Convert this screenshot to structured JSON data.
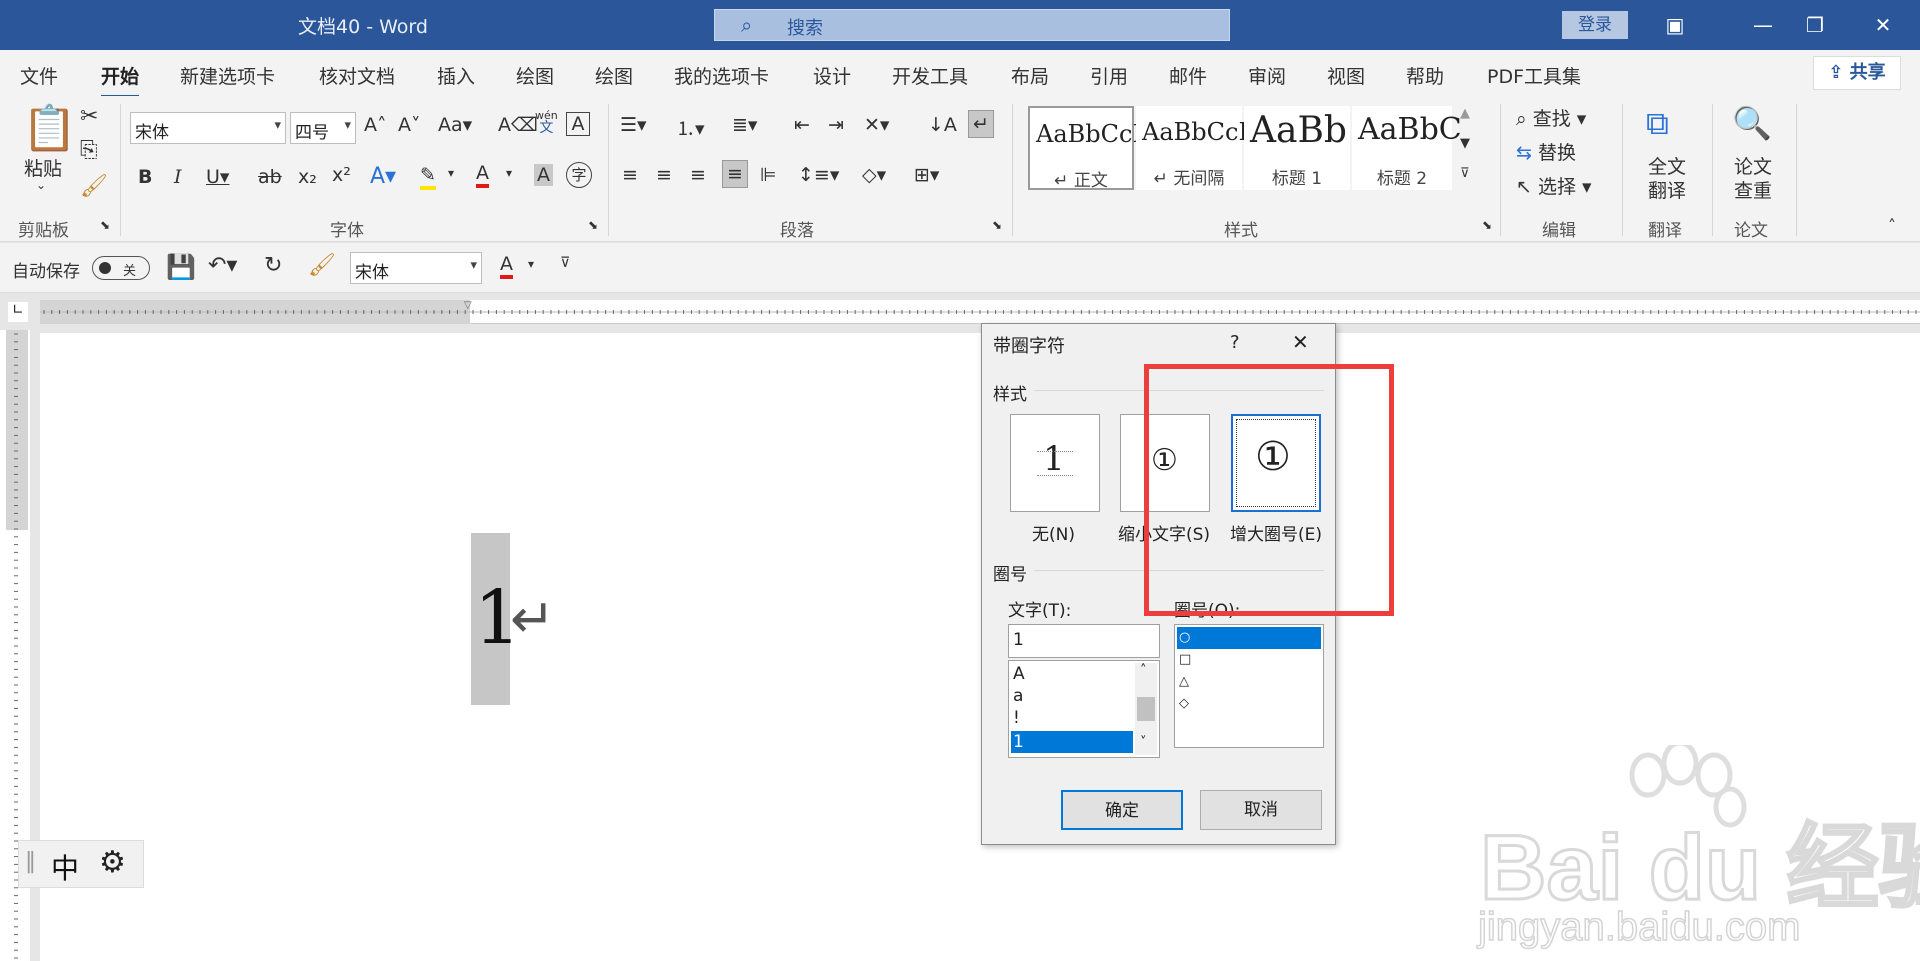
{
  "window": {
    "title": "文档40  -  Word",
    "search_placeholder": "搜索",
    "login": "登录"
  },
  "tabs": [
    {
      "label": "文件"
    },
    {
      "label": "开始"
    },
    {
      "label": "新建选项卡"
    },
    {
      "label": "核对文档"
    },
    {
      "label": "插入"
    },
    {
      "label": "绘图"
    },
    {
      "label": "绘图"
    },
    {
      "label": "我的选项卡"
    },
    {
      "label": "设计"
    },
    {
      "label": "开发工具"
    },
    {
      "label": "布局"
    },
    {
      "label": "引用"
    },
    {
      "label": "邮件"
    },
    {
      "label": "审阅"
    },
    {
      "label": "视图"
    },
    {
      "label": "帮助"
    },
    {
      "label": "PDF工具集"
    }
  ],
  "active_tab": "开始",
  "share_label": "共享",
  "ribbon": {
    "clipboard": {
      "paste": "粘贴",
      "group": "剪贴板"
    },
    "font": {
      "name": "宋体",
      "size": "四号",
      "group": "字体",
      "aa": "Aa",
      "wen": "wén",
      "wen2": "文"
    },
    "paragraph": {
      "group": "段落"
    },
    "styles": {
      "group": "样式",
      "items": [
        {
          "sample": "AaBbCcI",
          "name": "↵ 正文"
        },
        {
          "sample": "AaBbCcI",
          "name": "↵ 无间隔"
        },
        {
          "sample": "AaBb",
          "name": "标题 1"
        },
        {
          "sample": "AaBbC",
          "name": "标题 2"
        }
      ]
    },
    "editing": {
      "find": "查找",
      "replace": "替换",
      "select": "选择",
      "group": "编辑"
    },
    "translate": {
      "label1": "全文",
      "label2": "翻译",
      "group": "翻译"
    },
    "paper": {
      "label1": "论文",
      "label2": "查重",
      "group": "论文"
    }
  },
  "qat": {
    "autosave": "自动保存",
    "toggle": "关",
    "font": "宋体"
  },
  "document": {
    "char": "1",
    "mark": "↵"
  },
  "ime": {
    "lang": "中"
  },
  "dialog": {
    "title": "带圈字符",
    "help": "?",
    "close": "✕",
    "style_section": "样式",
    "options": [
      {
        "preview": "1",
        "label": "无(N)"
      },
      {
        "preview": "①",
        "label": "缩小文字(S)"
      },
      {
        "preview": "①",
        "label": "增大圈号(E)"
      }
    ],
    "selected_option": "增大圈号(E)",
    "circle_section": "圈号",
    "text_label": "文字(T):",
    "text_value": "1",
    "text_list": [
      "A",
      "a",
      "!",
      "1"
    ],
    "text_selected": "1",
    "shape_label": "圈号(O):",
    "shape_list": [
      "○",
      "□",
      "△",
      "◇"
    ],
    "shape_selected": "○",
    "ok": "确定",
    "cancel": "取消"
  },
  "watermark": {
    "brand": "Bai du 经验",
    "url": "jingyan.baidu.com"
  },
  "colors": {
    "title_bar": "#2b579a",
    "highlight_box": "#ee3d3d",
    "selection": "#0078d7"
  }
}
